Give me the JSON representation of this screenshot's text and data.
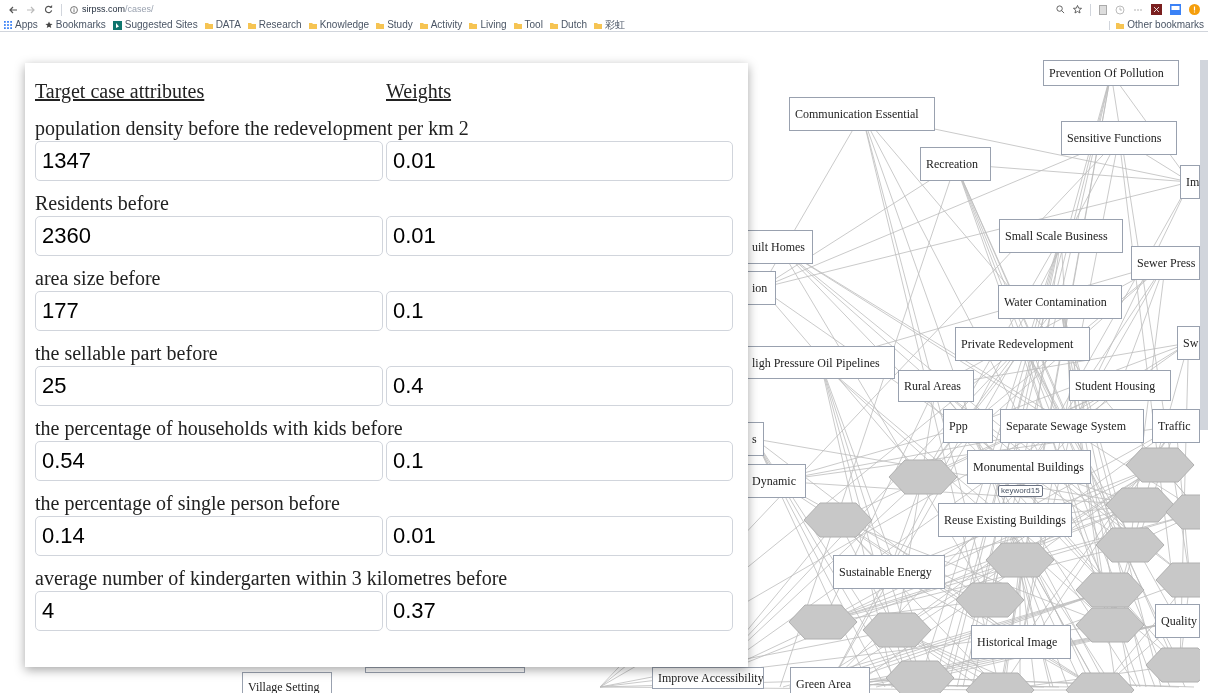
{
  "browser": {
    "url_host": "sirpss.com",
    "url_path": "/cases/",
    "bookmarks": [
      {
        "label": "Apps",
        "kind": "apps"
      },
      {
        "label": "Bookmarks",
        "kind": "star"
      },
      {
        "label": "Suggested Sites",
        "kind": "site"
      },
      {
        "label": "DATA",
        "kind": "folder"
      },
      {
        "label": "Research",
        "kind": "folder"
      },
      {
        "label": "Knowledge",
        "kind": "folder"
      },
      {
        "label": "Study",
        "kind": "folder"
      },
      {
        "label": "Activity",
        "kind": "folder"
      },
      {
        "label": "Living",
        "kind": "folder"
      },
      {
        "label": "Tool",
        "kind": "folder"
      },
      {
        "label": "Dutch",
        "kind": "folder"
      },
      {
        "label": "彩虹",
        "kind": "folder"
      }
    ],
    "other_bookmarks": "Other bookmarks"
  },
  "panel": {
    "headers": [
      "Target case attributes",
      "Weights"
    ],
    "attributes": [
      {
        "label": "population density before the redevelopment per km 2",
        "value": "1347",
        "weight": "0.01"
      },
      {
        "label": "Residents before",
        "value": "2360",
        "weight": "0.01"
      },
      {
        "label": "area size before",
        "value": "177",
        "weight": "0.1"
      },
      {
        "label": "the sellable part before",
        "value": "25",
        "weight": "0.4"
      },
      {
        "label": "the percentage of households with kids before",
        "value": "0.54",
        "weight": "0.1"
      },
      {
        "label": "the percentage of single person before",
        "value": "0.14",
        "weight": "0.01"
      },
      {
        "label": "average number of kindergarten within 3 kilometres before",
        "value": "4",
        "weight": "0.37"
      }
    ]
  },
  "graph": {
    "nodes": [
      {
        "label": "Prevention Of Pollution"
      },
      {
        "label": "Communication Essential"
      },
      {
        "label": "Sensitive Functions"
      },
      {
        "label": "Recreation"
      },
      {
        "label": "Im"
      },
      {
        "label": "uilt Homes"
      },
      {
        "label": "Small Scale Business"
      },
      {
        "label": "Sewer Press"
      },
      {
        "label": "ion"
      },
      {
        "label": "Water Contamination"
      },
      {
        "label": "Private Redevelopment"
      },
      {
        "label": "Sw"
      },
      {
        "label": "ligh Pressure Oil Pipelines"
      },
      {
        "label": "Rural Areas"
      },
      {
        "label": "Student Housing"
      },
      {
        "label": "Ppp"
      },
      {
        "label": "Separate Sewage System"
      },
      {
        "label": "Traffic"
      },
      {
        "label": "s"
      },
      {
        "label": "Dynamic"
      },
      {
        "label": "Monumental Buildings"
      },
      {
        "label": "Reuse Existing Buildings"
      },
      {
        "label": "Sustainable Energy"
      },
      {
        "label": "Historical Image"
      },
      {
        "label": "Quality"
      },
      {
        "label": "Village Setting"
      },
      {
        "label": "Improve Accessibility"
      },
      {
        "label": "Green Area"
      }
    ],
    "tag": "keyword15"
  }
}
